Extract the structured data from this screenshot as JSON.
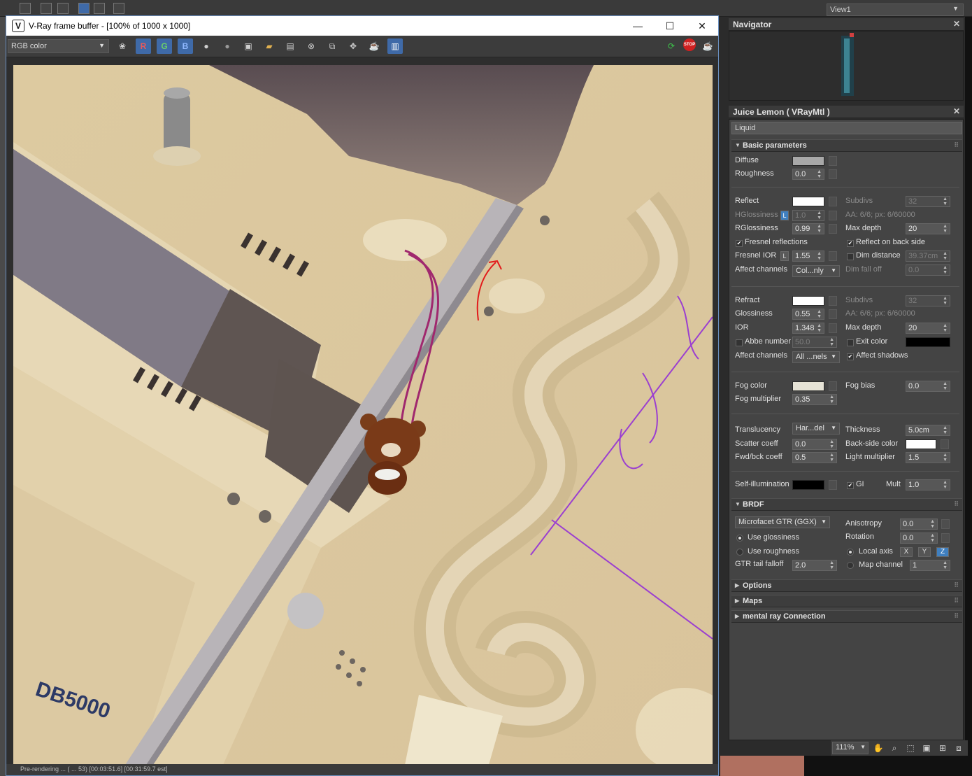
{
  "topbar": {
    "view_label": "View1"
  },
  "vfb": {
    "title": "V-Ray frame buffer - [100% of 1000 x 1000]",
    "channel": "RGB color",
    "render_text": "DB5000",
    "status_text": "Pre-rendering ...   ( ... 53) [00:03:51.6] [00:31:59.7 est]"
  },
  "navigator": {
    "title": "Navigator"
  },
  "material": {
    "title": "Juice Lemon  ( VRayMtl )",
    "name": "Liquid",
    "rollouts": {
      "basic": "Basic parameters",
      "brdf": "BRDF",
      "options": "Options",
      "maps": "Maps",
      "mentalray": "mental ray Connection"
    },
    "diffuse": {
      "label": "Diffuse",
      "color": "#a8a8a8"
    },
    "roughness": {
      "label": "Roughness",
      "value": "0.0"
    },
    "reflect": {
      "label": "Reflect",
      "color": "#ffffff"
    },
    "subdivs_refl": {
      "label": "Subdivs",
      "value": "32"
    },
    "hglossiness": {
      "label": "HGlossiness",
      "lock": "L",
      "value": "1.0"
    },
    "aa_refl": "AA: 6/6; px: 6/60000",
    "rglossiness": {
      "label": "RGlossiness",
      "value": "0.99"
    },
    "maxdepth_refl": {
      "label": "Max depth",
      "value": "20"
    },
    "fresnel": {
      "label": "Fresnel reflections",
      "checked": true
    },
    "reflect_back": {
      "label": "Reflect on back side",
      "checked": true
    },
    "fresnel_ior": {
      "label": "Fresnel IOR",
      "lock": "L",
      "value": "1.55"
    },
    "dim_distance": {
      "label": "Dim distance",
      "value": "39.37cm"
    },
    "affect_channels_refl": {
      "label": "Affect channels",
      "value": "Col...nly"
    },
    "dim_falloff": {
      "label": "Dim fall off",
      "value": "0.0"
    },
    "refract": {
      "label": "Refract",
      "color": "#ffffff"
    },
    "subdivs_refr": {
      "label": "Subdivs",
      "value": "32"
    },
    "glossiness": {
      "label": "Glossiness",
      "value": "0.55"
    },
    "aa_refr": "AA: 6/6; px: 6/60000",
    "ior": {
      "label": "IOR",
      "value": "1.348"
    },
    "maxdepth_refr": {
      "label": "Max depth",
      "value": "20"
    },
    "abbe": {
      "label": "Abbe number",
      "value": "50.0"
    },
    "exit_color": {
      "label": "Exit color",
      "color": "#000000"
    },
    "affect_channels_refr": {
      "label": "Affect channels",
      "value": "All ...nels"
    },
    "affect_shadows": {
      "label": "Affect shadows",
      "checked": true
    },
    "fog_color": {
      "label": "Fog color",
      "color": "#e6e3d6"
    },
    "fog_bias": {
      "label": "Fog bias",
      "value": "0.0"
    },
    "fog_multiplier": {
      "label": "Fog multiplier",
      "value": "0.35"
    },
    "translucency": {
      "label": "Translucency",
      "value": "Har...del"
    },
    "thickness": {
      "label": "Thickness",
      "value": "5.0cm"
    },
    "scatter": {
      "label": "Scatter coeff",
      "value": "0.0"
    },
    "backside": {
      "label": "Back-side color",
      "color": "#ffffff"
    },
    "fwdbck": {
      "label": "Fwd/bck coeff",
      "value": "0.5"
    },
    "light_mult": {
      "label": "Light multiplier",
      "value": "1.5"
    },
    "selfillum": {
      "label": "Self-illumination",
      "color": "#000000"
    },
    "gi": {
      "label": "GI",
      "checked": true
    },
    "mult": {
      "label": "Mult",
      "value": "1.0"
    },
    "brdf_type": "Microfacet GTR (GGX)",
    "anisotropy": {
      "label": "Anisotropy",
      "value": "0.0"
    },
    "use_glossiness": "Use glossiness",
    "rotation": {
      "label": "Rotation",
      "value": "0.0"
    },
    "use_roughness": "Use roughness",
    "local_axis": {
      "label": "Local axis",
      "axes": [
        "X",
        "Y",
        "Z"
      ]
    },
    "gtr_falloff": {
      "label": "GTR tail falloff",
      "value": "2.0"
    },
    "map_channel": {
      "label": "Map channel",
      "value": "1"
    }
  },
  "bottom": {
    "zoom": "111%"
  }
}
